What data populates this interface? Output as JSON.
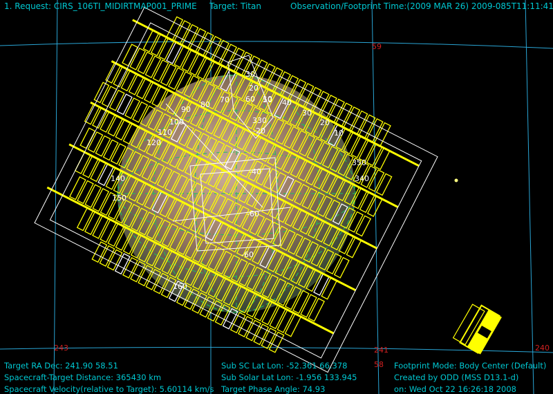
{
  "header": {
    "request": "1. Request: CIRS_106TI_MIDIRTMAP001_PRIME",
    "target": "Target: Titan",
    "obs_time": "Observation/Footprint Time:(2009 MAR 26) 2009-085T11:11:41.25"
  },
  "grid_labels": {
    "dec_59": "59",
    "dec_58": "58",
    "ra_243": "243",
    "ra_241": "241",
    "ra_240": "240"
  },
  "body_labels": {
    "lat_30": "30",
    "lat_20": "20",
    "lat_10": "10",
    "lat_neg20": "-20",
    "lat_neg40": "-40",
    "lat_neg60": "-60",
    "lat_neg60b": "-60",
    "lon_40": "40",
    "lon_30": "30",
    "lon_20": "20",
    "lon_10": "10",
    "lon_50": "50",
    "lon_60": "60",
    "lon_70": "70",
    "lon_80": "80",
    "lon_90": "90",
    "lon_100": "100",
    "lon_110": "110",
    "lon_120": "120",
    "lon_140": "140",
    "lon_150": "150",
    "lon_160": "160",
    "lon_350": "350",
    "lon_340": "340",
    "lon_330": "330"
  },
  "info_left": {
    "ra_dec": "Target RA Dec: 241.90  58.51",
    "distance": "Spacecraft-Target Distance:  365430 km",
    "velocity": "Spacecraft Velocity(relative to Target): 5.60114 km/s"
  },
  "info_mid": {
    "sub_sc": "Sub SC Lat Lon: -52.361  66.378",
    "sub_solar": "Sub Solar Lat Lon: -1.956  133.945",
    "phase": "Target Phase Angle: 74.93"
  },
  "info_right": {
    "mode": "Footprint Mode: Body Center (Default)",
    "created": "Created by ODD (MSS D13.1-d)",
    "date": "on: Wed Oct 22 16:26:18 2008"
  },
  "colors": {
    "text": "#00c8d2",
    "grid": "#2aa6d6",
    "footprint": "#ffff00",
    "outline": "#ffffff",
    "body_grid": "#20c060",
    "grid_label": "#d22020"
  }
}
